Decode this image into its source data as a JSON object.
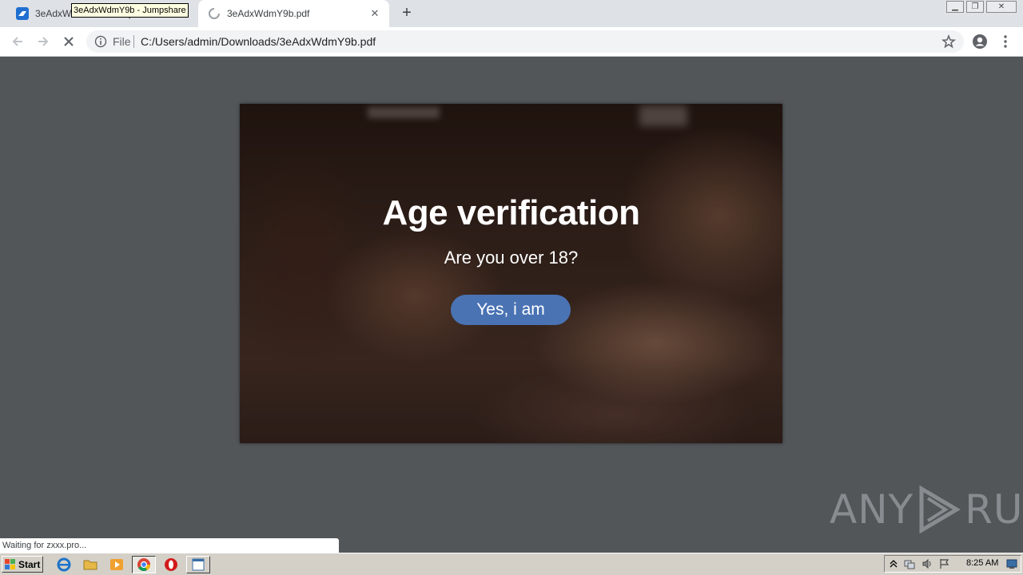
{
  "browser": {
    "tabs": [
      {
        "title": "3eAdxWdmY9b - Jumpshare",
        "active": false,
        "close_glyph": "✕"
      },
      {
        "title": "3eAdxWdmY9b.pdf",
        "active": true,
        "close_glyph": "✕"
      }
    ],
    "tooltip": "3eAdxWdmY9b - Jumpshare",
    "new_tab_glyph": "+",
    "omnibox": {
      "scheme_label": "File",
      "url": "C:/Users/admin/Downloads/3eAdxWdmY9b.pdf"
    },
    "status_bubble": "Waiting for zxxx.pro..."
  },
  "document": {
    "title": "Age verification",
    "question": "Are you over 18?",
    "button_label": "Yes, i am",
    "button_color": "#4a73b4"
  },
  "watermark": {
    "left": "ANY",
    "right": "RUN"
  },
  "taskbar": {
    "start_label": "Start",
    "clock": "8:25 AM"
  }
}
